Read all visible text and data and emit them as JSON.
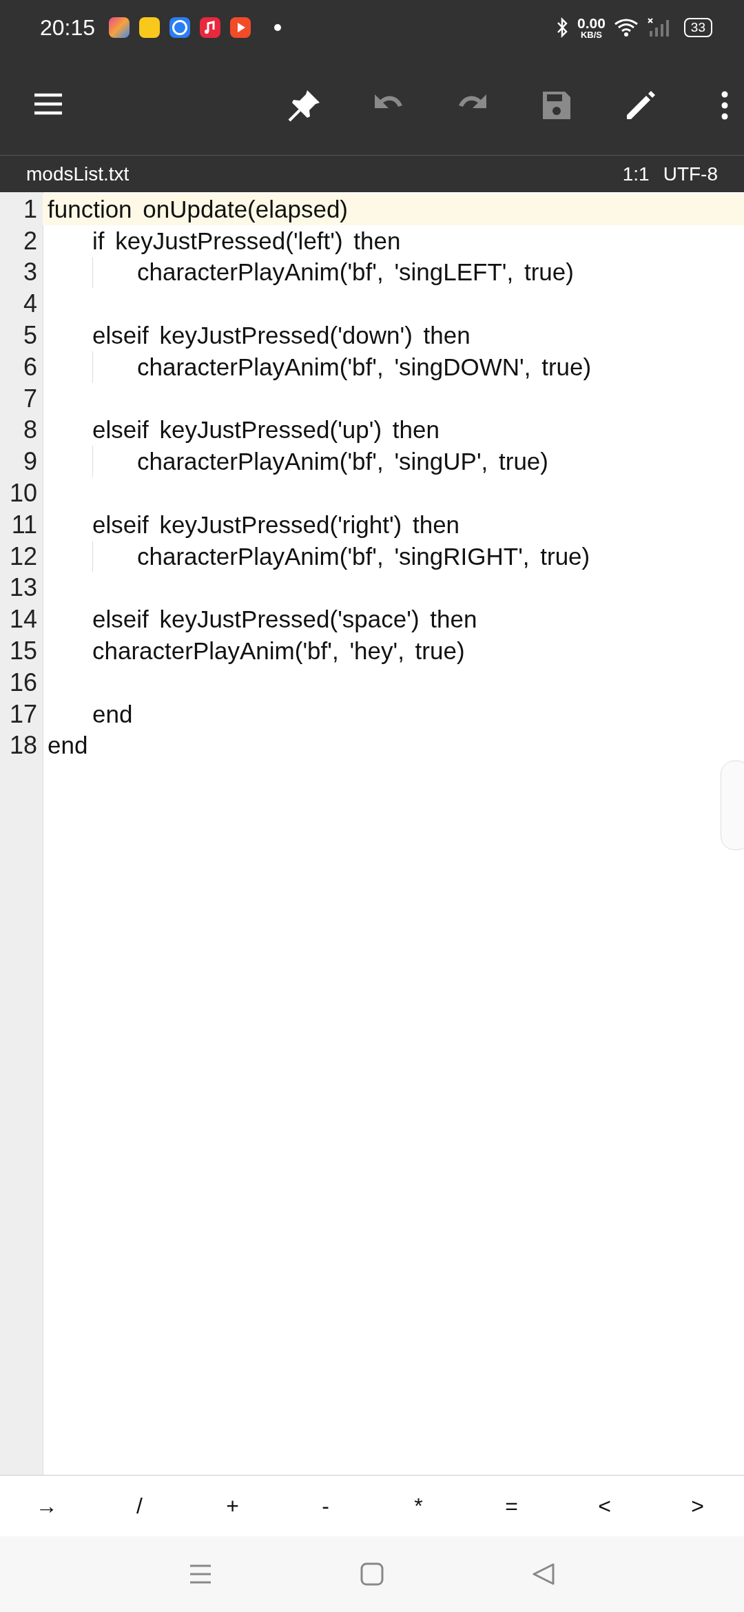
{
  "status_bar": {
    "time": "20:15",
    "net_speed": "0.00",
    "net_unit": "KB/S",
    "battery": "33"
  },
  "toolbar": {
    "buttons": [
      {
        "kind": "menu",
        "disabled": false
      },
      {
        "kind": "pin",
        "disabled": false
      },
      {
        "kind": "undo",
        "disabled": true
      },
      {
        "kind": "redo",
        "disabled": true
      },
      {
        "kind": "save",
        "disabled": true
      },
      {
        "kind": "edit",
        "disabled": false
      },
      {
        "kind": "more",
        "disabled": false
      }
    ]
  },
  "file_bar": {
    "filename": "modsList.txt",
    "position": "1:1",
    "encoding": "UTF-8"
  },
  "editor": {
    "lines": [
      {
        "number": "1",
        "text": "function onUpdate(elapsed)",
        "selected": true,
        "children": [
          {
            "number": "2",
            "text": "if keyJustPressed('left') then",
            "selected": false,
            "children": [
              {
                "number": "3",
                "text": "characterPlayAnim('bf', 'singLEFT', true)",
                "selected": false
              }
            ]
          },
          {
            "number": "4",
            "selected": false
          },
          {
            "number": "5",
            "text": "elseif keyJustPressed('down') then",
            "selected": false,
            "children": [
              {
                "number": "6",
                "text": "characterPlayAnim('bf', 'singDOWN', true)",
                "selected": false
              }
            ]
          },
          {
            "number": "7",
            "selected": false
          },
          {
            "number": "8",
            "text": "elseif keyJustPressed('up') then",
            "selected": false,
            "children": [
              {
                "number": "9",
                "text": "characterPlayAnim('bf', 'singUP', true)",
                "selected": false
              }
            ]
          },
          {
            "number": "10",
            "selected": false
          },
          {
            "number": "11",
            "text": "elseif keyJustPressed('right') then",
            "selected": false,
            "children": [
              {
                "number": "12",
                "text": "characterPlayAnim('bf', 'singRIGHT', true)",
                "selected": false
              }
            ]
          },
          {
            "number": "13",
            "selected": false
          },
          {
            "number": "14",
            "text": "elseif keyJustPressed('space') then",
            "selected": false
          },
          {
            "number": "15",
            "text": "characterPlayAnim('bf', 'hey', true)",
            "selected": false
          },
          {
            "number": "16",
            "selected": false
          },
          {
            "number": "17",
            "text": "end",
            "selected": false
          }
        ]
      },
      {
        "number": "18",
        "text": "end",
        "selected": false
      }
    ]
  },
  "extra_keys": [
    "→",
    "/",
    "+",
    "-",
    "*",
    "=",
    "<",
    ">"
  ]
}
